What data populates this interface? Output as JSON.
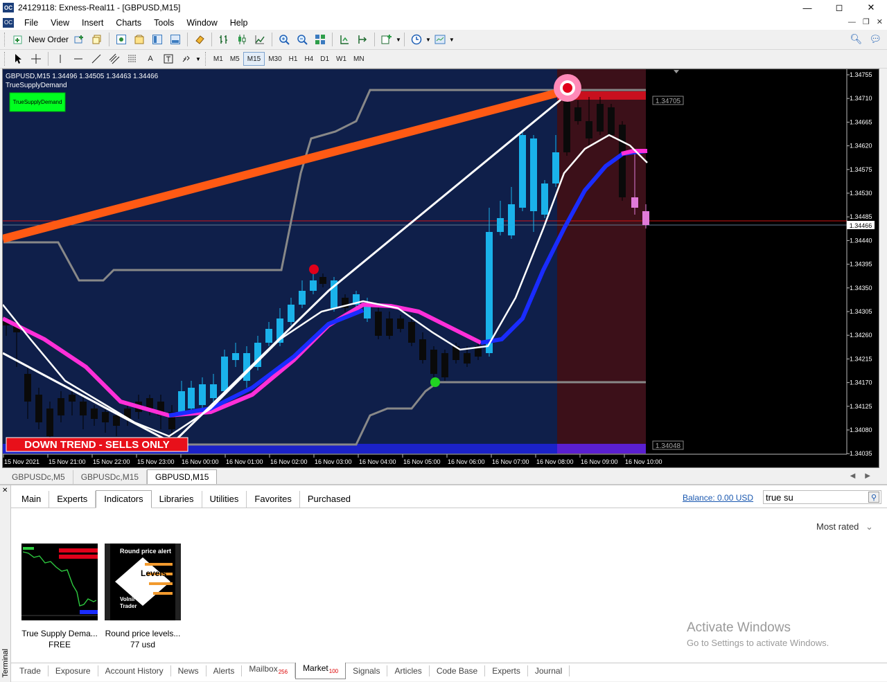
{
  "window": {
    "title": "24129118: Exness-Real11 - [GBPUSD,M15]",
    "app_icon_text": "OC"
  },
  "menu": [
    "File",
    "View",
    "Insert",
    "Charts",
    "Tools",
    "Window",
    "Help"
  ],
  "toolbar": {
    "new_order_label": "New Order",
    "timeframes": [
      "M1",
      "M5",
      "M15",
      "M30",
      "H1",
      "H4",
      "D1",
      "W1",
      "MN"
    ],
    "active_timeframe": "M15"
  },
  "chart": {
    "header_line": "GBPUSD,M15  1.34496 1.34505 1.34463 1.34466",
    "indicator_name": "TrueSupplyDemand",
    "indicator_button": "TrueSupplyDemand",
    "trend_banner": "DOWN TREND - SELLS ONLY",
    "level_upper": "1.34705",
    "level_lower": "1.34048",
    "current_price": "1.34466",
    "price_axis": [
      "1.34755",
      "1.34710",
      "1.34665",
      "1.34620",
      "1.34575",
      "1.34530",
      "1.34485",
      "1.34440",
      "1.34395",
      "1.34350",
      "1.34305",
      "1.34260",
      "1.34215",
      "1.34170",
      "1.34125",
      "1.34080",
      "1.34035"
    ],
    "time_axis": [
      "15 Nov 2021",
      "15 Nov 21:00",
      "15 Nov 22:00",
      "15 Nov 23:00",
      "16 Nov 00:00",
      "16 Nov 01:00",
      "16 Nov 02:00",
      "16 Nov 03:00",
      "16 Nov 04:00",
      "16 Nov 05:00",
      "16 Nov 06:00",
      "16 Nov 07:00",
      "16 Nov 08:00",
      "16 Nov 09:00",
      "16 Nov 10:00"
    ],
    "colors": {
      "bg": "#0f1f4a",
      "sell_zone": "#3c1019",
      "bull": "#1ab2ea",
      "bear": "#000000",
      "trend": "#ff5a14"
    }
  },
  "chart_tabs": [
    "GBPUSDc,M5",
    "GBPUSDc,M15",
    "GBPUSD,M15"
  ],
  "chart_tabs_active": 2,
  "market": {
    "tabs": [
      "Main",
      "Experts",
      "Indicators",
      "Libraries",
      "Utilities",
      "Favorites",
      "Purchased"
    ],
    "active_tab": 2,
    "balance": "Balance: 0.00 USD",
    "search_value": "true su",
    "sort_label": "Most rated",
    "products": [
      {
        "name": "True Supply Dema...",
        "price": "FREE"
      },
      {
        "name": "Round price levels...",
        "price": "77 usd",
        "thumb_title": "Round price alert",
        "thumb_levels": "Levels",
        "thumb_brand1": "Volnii",
        "thumb_brand2": "Trader"
      }
    ]
  },
  "terminal": {
    "side_label": "Terminal",
    "tabs": [
      {
        "label": "Trade"
      },
      {
        "label": "Exposure"
      },
      {
        "label": "Account History"
      },
      {
        "label": "News"
      },
      {
        "label": "Alerts"
      },
      {
        "label": "Mailbox",
        "badge": "256"
      },
      {
        "label": "Market",
        "badge": "100"
      },
      {
        "label": "Signals"
      },
      {
        "label": "Articles"
      },
      {
        "label": "Code Base"
      },
      {
        "label": "Experts"
      },
      {
        "label": "Journal"
      }
    ],
    "active_tab": 6
  },
  "watermark": {
    "line1": "Activate Windows",
    "line2": "Go to Settings to activate Windows."
  }
}
